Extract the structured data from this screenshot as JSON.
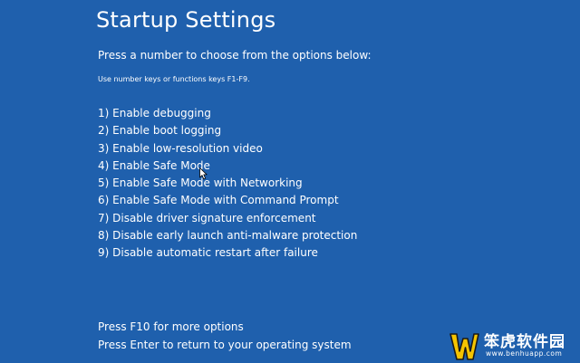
{
  "screen": {
    "title": "Startup Settings",
    "instruction": "Press a number to choose from the options below:",
    "hint": "Use number keys or functions keys F1-F9."
  },
  "options": [
    {
      "label": "1) Enable debugging"
    },
    {
      "label": "2) Enable boot logging"
    },
    {
      "label": "3) Enable low-resolution video"
    },
    {
      "label": "4) Enable Safe Mode"
    },
    {
      "label": "5) Enable Safe Mode with Networking"
    },
    {
      "label": "6) Enable Safe Mode with Command Prompt"
    },
    {
      "label": "7) Disable driver signature enforcement"
    },
    {
      "label": "8) Disable early launch anti-malware protection"
    },
    {
      "label": "9) Disable automatic restart after failure"
    }
  ],
  "footer": {
    "more_options": "Press F10 for more options",
    "return": "Press Enter to return to your operating system"
  },
  "watermark": {
    "name": "笨虎软件园",
    "url": "www.benhuapp.com"
  },
  "icons": {
    "cursor": "mouse-pointer-icon",
    "logo": "benhu-logo-icon"
  },
  "colors": {
    "background": "#1f60ad",
    "text": "#ffffff",
    "logo_yellow": "#f5c400"
  }
}
